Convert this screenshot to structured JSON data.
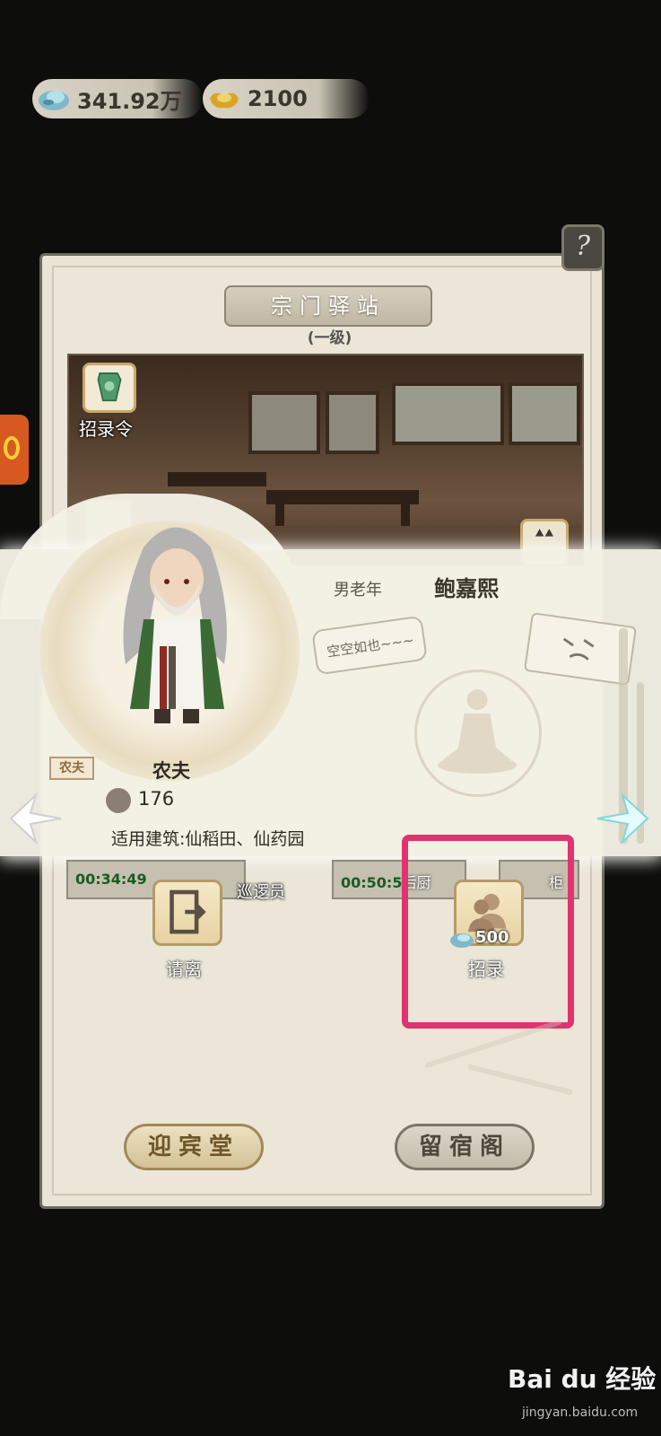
{
  "currencies": [
    {
      "name": "spirit-stone",
      "value": "341.92万"
    },
    {
      "name": "gold-ingot",
      "value": "2100"
    }
  ],
  "panel": {
    "title": "宗门驿站",
    "level": "(一级)",
    "help_label": "?",
    "recruit_token_label": "招录令"
  },
  "character": {
    "gender_age": "男老年",
    "name": "鲍嘉熙",
    "speech": "空空如也~~~",
    "job_tag": "农夫",
    "job": "农夫",
    "power": "176",
    "suitable_buildings": "适用建筑:仙稻田、仙药园"
  },
  "background_slots": [
    {
      "timer": "00:34:49",
      "role": "巡逻员"
    },
    {
      "timer": "00:50:5",
      "role": "后厨"
    },
    {
      "timer": "",
      "role": "柜"
    }
  ],
  "actions": {
    "dismiss_label": "请离",
    "recruit_label": "招录",
    "recruit_cost": "500"
  },
  "halls": {
    "guest_hall": "迎宾堂",
    "lodging_hall": "留宿阁"
  },
  "watermark": {
    "brand": "Bai du 经验",
    "url": "jingyan.baidu.com"
  },
  "colors": {
    "highlight": "#e1336f",
    "timer_text": "#175d20"
  }
}
